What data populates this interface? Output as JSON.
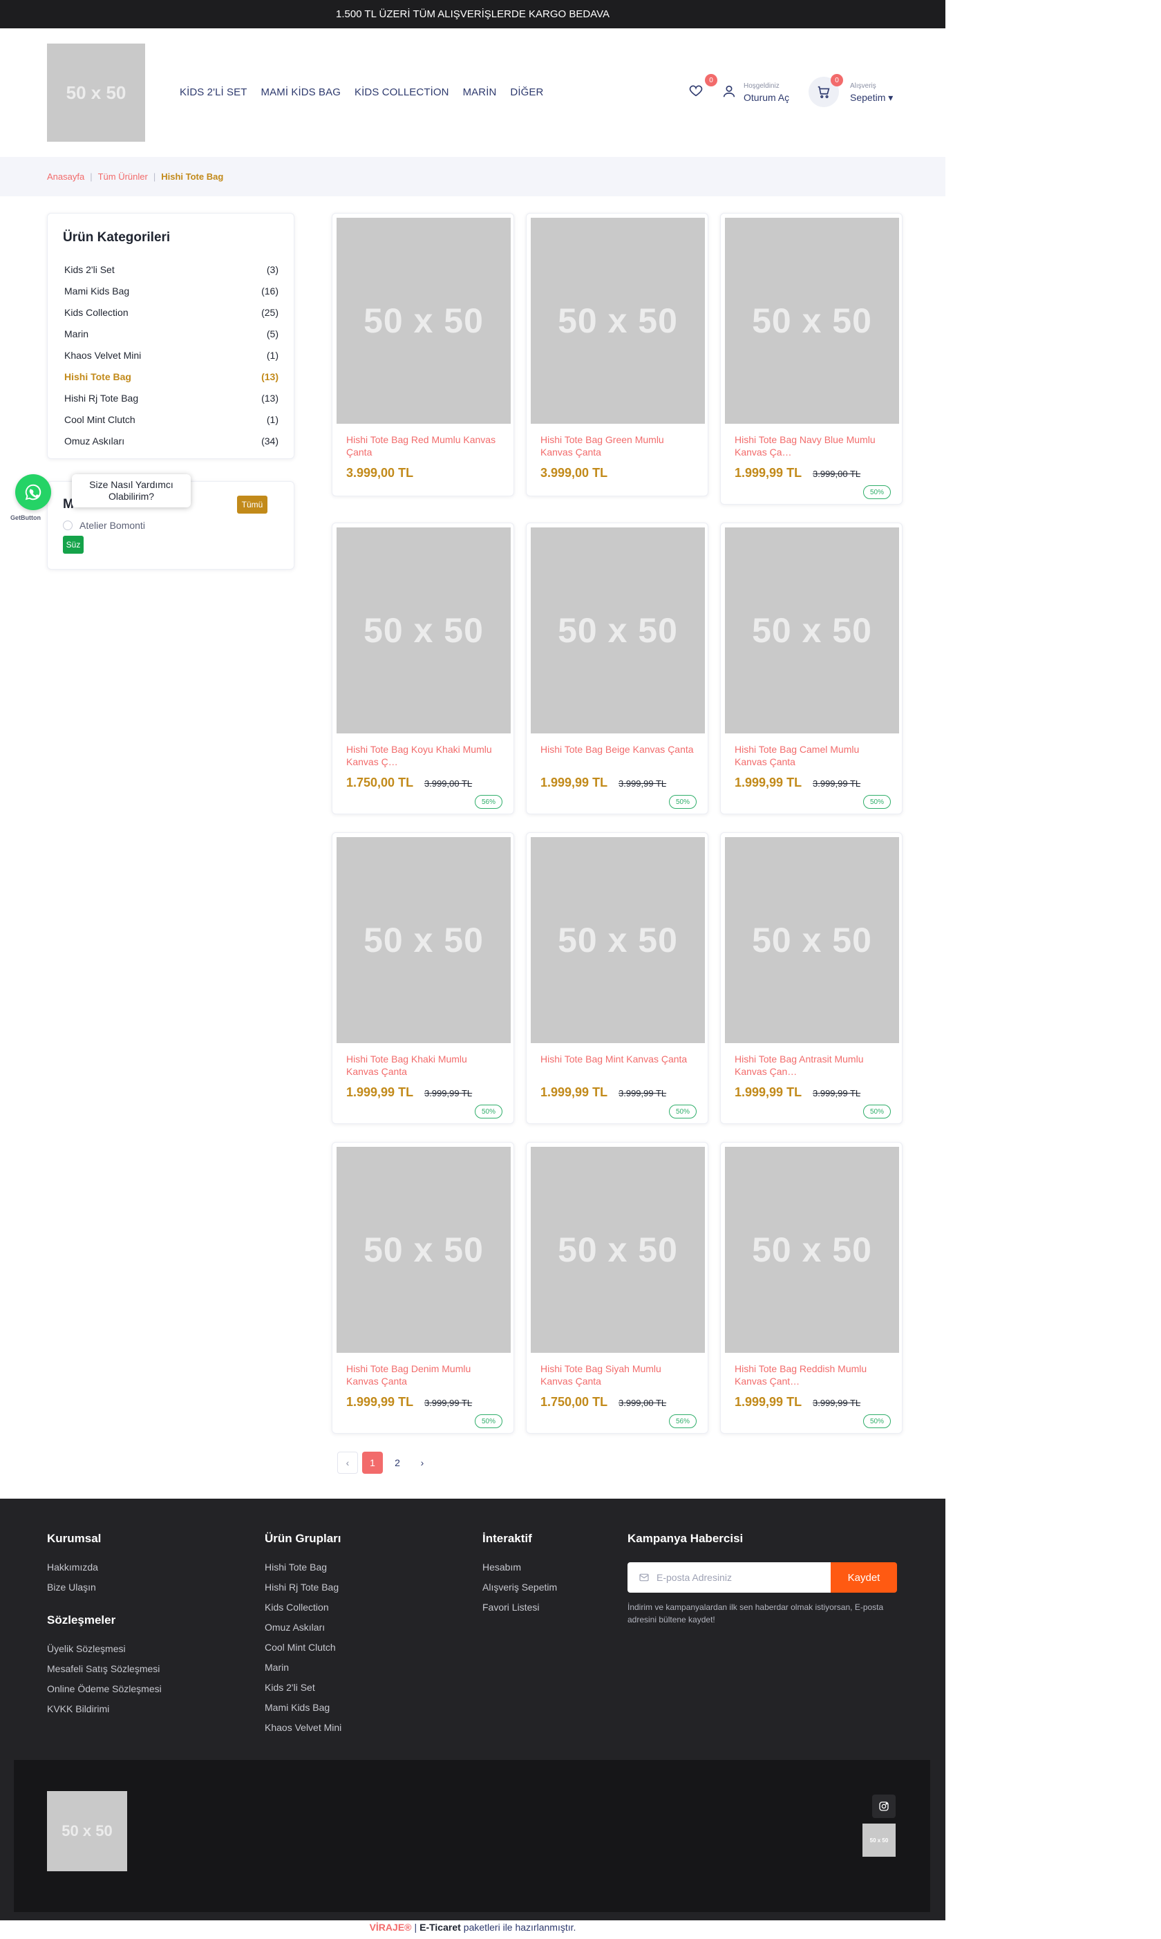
{
  "topbar": {
    "text": "1.500 TL ÜZERİ TÜM ALIŞVERİŞLERDE KARGO BEDAVA"
  },
  "header": {
    "logo": "50 x 50",
    "nav": [
      "KİDS 2'Lİ SET",
      "MAMİ KİDS BAG",
      "KİDS COLLECTİON",
      "MARİN",
      "DİĞER"
    ],
    "wishlist_count": "0",
    "user_small": "Hoşgeldiniz",
    "user_main": "Oturum Aç",
    "cart_count": "0",
    "cart_small": "Alışveriş",
    "cart_main": "Sepetim ▾"
  },
  "breadcrumb": {
    "home": "Anasayfa",
    "all": "Tüm Ürünler",
    "current": "Hishi Tote Bag",
    "sep": "|"
  },
  "categories": {
    "title": "Ürün Kategorileri",
    "items": [
      {
        "label": "Kids 2'li Set",
        "count": "(3)"
      },
      {
        "label": "Mami Kids Bag",
        "count": "(16)"
      },
      {
        "label": "Kids Collection",
        "count": "(25)"
      },
      {
        "label": "Marin",
        "count": "(5)"
      },
      {
        "label": "Khaos Velvet Mini",
        "count": "(1)"
      },
      {
        "label": "Hishi Tote Bag",
        "count": "(13)"
      },
      {
        "label": "Hishi Rj Tote Bag",
        "count": "(13)"
      },
      {
        "label": "Cool Mint Clutch",
        "count": "(1)"
      },
      {
        "label": "Omuz Askıları",
        "count": "(34)"
      }
    ]
  },
  "brands": {
    "title": "M",
    "all_button": "Tümü",
    "option": "Atelier Bomonti",
    "filter_button": "Süz"
  },
  "whatsapp": {
    "bubble": "Size Nasıl Yardımcı Olabilirim?",
    "label": "GetButton"
  },
  "products": [
    {
      "name": "Hishi Tote Bag Red Mumlu Kanvas Çanta",
      "price": "3.999,00 TL",
      "old": "",
      "discount": "",
      "img": "50 x 50"
    },
    {
      "name": "Hishi Tote Bag Green Mumlu Kanvas Çanta",
      "price": "3.999,00 TL",
      "old": "",
      "discount": "",
      "img": "50 x 50"
    },
    {
      "name": "Hishi Tote Bag Navy Blue Mumlu Kanvas Ça…",
      "price": "1.999,99 TL",
      "old": "3.999,00 TL",
      "discount": "50%",
      "img": "50 x 50"
    },
    {
      "name": "Hishi Tote Bag Koyu Khaki Mumlu Kanvas Ç…",
      "price": "1.750,00 TL",
      "old": "3.999,00 TL",
      "discount": "56%",
      "img": "50 x 50"
    },
    {
      "name": "Hishi Tote Bag Beige Kanvas Çanta",
      "price": "1.999,99 TL",
      "old": "3.999,99 TL",
      "discount": "50%",
      "img": "50 x 50"
    },
    {
      "name": "Hishi Tote Bag Camel Mumlu Kanvas Çanta",
      "price": "1.999,99 TL",
      "old": "3.999,99 TL",
      "discount": "50%",
      "img": "50 x 50"
    },
    {
      "name": "Hishi Tote Bag Khaki Mumlu Kanvas Çanta",
      "price": "1.999,99 TL",
      "old": "3.999,99 TL",
      "discount": "50%",
      "img": "50 x 50"
    },
    {
      "name": "Hishi Tote Bag Mint Kanvas Çanta",
      "price": "1.999,99 TL",
      "old": "3.999,99 TL",
      "discount": "50%",
      "img": "50 x 50"
    },
    {
      "name": "Hishi Tote Bag Antrasit Mumlu Kanvas Çan…",
      "price": "1.999,99 TL",
      "old": "3.999,99 TL",
      "discount": "50%",
      "img": "50 x 50"
    },
    {
      "name": "Hishi Tote Bag Denim Mumlu Kanvas Çanta",
      "price": "1.999,99 TL",
      "old": "3.999,99 TL",
      "discount": "50%",
      "img": "50 x 50"
    },
    {
      "name": "Hishi Tote Bag Siyah Mumlu Kanvas Çanta",
      "price": "1.750,00 TL",
      "old": "3.999,00 TL",
      "discount": "56%",
      "img": "50 x 50"
    },
    {
      "name": "Hishi Tote Bag Reddish Mumlu Kanvas Çant…",
      "price": "1.999,99 TL",
      "old": "3.999,99 TL",
      "discount": "50%",
      "img": "50 x 50"
    }
  ],
  "pagination": {
    "prev": "‹",
    "pages": [
      "1",
      "2"
    ],
    "next": "›",
    "active": "1"
  },
  "footer": {
    "kurumsal": {
      "title": "Kurumsal",
      "links": [
        "Hakkımızda",
        "Bize Ulaşın"
      ]
    },
    "sozlesmeler": {
      "title": "Sözleşmeler",
      "links": [
        "Üyelik Sözleşmesi",
        "Mesafeli Satış Sözleşmesi",
        "Online Ödeme Sözleşmesi",
        "KVKK Bildirimi"
      ]
    },
    "urun_gruplari": {
      "title": "Ürün Grupları",
      "links": [
        "Hishi Tote Bag",
        "Hishi Rj Tote Bag",
        "Kids Collection",
        "Omuz Askıları",
        "Cool Mint Clutch",
        "Marin",
        "Kids 2'li Set",
        "Mami Kids Bag",
        "Khaos Velvet Mini"
      ]
    },
    "interaktif": {
      "title": "İnteraktif",
      "links": [
        "Hesabım",
        "Alışveriş Sepetim",
        "Favori Listesi"
      ]
    },
    "newsletter": {
      "title": "Kampanya Habercisi",
      "placeholder": "E-posta Adresiniz",
      "button": "Kaydet",
      "note": "İndirim ve kampanyalardan ilk sen haberdar olmak istiyorsan, E-posta adresini bültene kaydet!"
    },
    "logo": "50 x 50",
    "badge": "50 x 50"
  },
  "credit": {
    "brand": "VİRAJE®",
    "sep": "|",
    "et": "E-Ticaret",
    "rest": "paketleri ile hazırlanmıştır."
  },
  "colors": {
    "accent": "#f26b6b",
    "gold": "#c28a1a",
    "navy": "#2e3a6e",
    "green": "#15a34a",
    "orange": "#ff5a12",
    "footer": "#232326"
  }
}
